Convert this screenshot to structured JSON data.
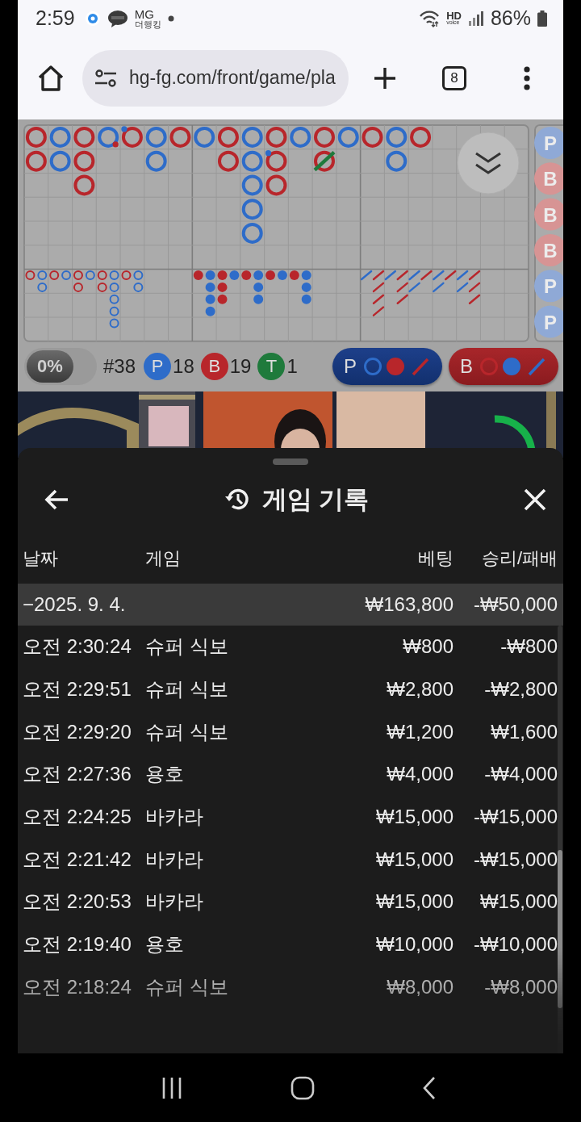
{
  "status_bar": {
    "time": "2:59",
    "app_label": "MG",
    "app_sublabel": "더행킹",
    "network": "HD",
    "network_sub": "voice",
    "battery": "86%"
  },
  "browser": {
    "url": "hg-fg.com/front/game/pla",
    "tab_count": "8"
  },
  "roadmap": {
    "big_road": [
      [
        {
          "kind": "banker",
          "player_pair": false,
          "banker_pair": false,
          "tie": false
        },
        {
          "kind": "banker",
          "player_pair": false,
          "banker_pair": false,
          "tie": false
        }
      ],
      [
        {
          "kind": "player",
          "player_pair": false,
          "banker_pair": false,
          "tie": false
        },
        {
          "kind": "player",
          "player_pair": false,
          "banker_pair": false,
          "tie": false
        }
      ],
      [
        {
          "kind": "banker",
          "player_pair": false,
          "banker_pair": false,
          "tie": false
        },
        {
          "kind": "banker",
          "player_pair": false,
          "banker_pair": false,
          "tie": false
        },
        {
          "kind": "banker",
          "player_pair": false,
          "banker_pair": false,
          "tie": false
        }
      ],
      [
        {
          "kind": "player",
          "player_pair": false,
          "banker_pair": true,
          "tie": false
        }
      ],
      [
        {
          "kind": "banker",
          "player_pair": true,
          "banker_pair": false,
          "tie": false
        }
      ],
      [
        {
          "kind": "player",
          "player_pair": false,
          "banker_pair": false,
          "tie": false
        },
        {
          "kind": "player",
          "player_pair": false,
          "banker_pair": false,
          "tie": false
        }
      ],
      [
        {
          "kind": "banker",
          "player_pair": false,
          "banker_pair": false,
          "tie": false
        }
      ],
      [
        {
          "kind": "player",
          "player_pair": false,
          "banker_pair": false,
          "tie": false
        }
      ],
      [
        {
          "kind": "banker",
          "player_pair": false,
          "banker_pair": false,
          "tie": false
        },
        {
          "kind": "banker",
          "player_pair": false,
          "banker_pair": false,
          "tie": false
        }
      ],
      [
        {
          "kind": "player",
          "player_pair": false,
          "banker_pair": false,
          "tie": false
        },
        {
          "kind": "player",
          "player_pair": false,
          "banker_pair": false,
          "tie": false
        },
        {
          "kind": "player",
          "player_pair": false,
          "banker_pair": false,
          "tie": false
        },
        {
          "kind": "player",
          "player_pair": false,
          "banker_pair": false,
          "tie": false
        },
        {
          "kind": "player",
          "player_pair": false,
          "banker_pair": false,
          "tie": false
        }
      ],
      [
        {
          "kind": "banker",
          "player_pair": false,
          "banker_pair": false,
          "tie": false
        },
        {
          "kind": "banker",
          "player_pair": true,
          "banker_pair": false,
          "tie": false
        },
        {
          "kind": "banker",
          "player_pair": false,
          "banker_pair": false,
          "tie": false
        }
      ],
      [
        {
          "kind": "player",
          "player_pair": false,
          "banker_pair": false,
          "tie": false
        }
      ],
      [
        {
          "kind": "banker",
          "player_pair": false,
          "banker_pair": false,
          "tie": false
        },
        {
          "kind": "banker",
          "player_pair": false,
          "banker_pair": false,
          "tie": true
        }
      ],
      [
        {
          "kind": "player",
          "player_pair": false,
          "banker_pair": false,
          "tie": false
        }
      ],
      [
        {
          "kind": "banker",
          "player_pair": false,
          "banker_pair": false,
          "tie": false
        }
      ],
      [
        {
          "kind": "player",
          "player_pair": false,
          "banker_pair": false,
          "tie": false
        },
        {
          "kind": "player",
          "player_pair": false,
          "banker_pair": false,
          "tie": false
        }
      ],
      [
        {
          "kind": "banker",
          "player_pair": false,
          "banker_pair": false,
          "tie": false
        }
      ]
    ],
    "big_eye_road": [
      [
        {
          "kind": "banker"
        }
      ],
      [
        {
          "kind": "player"
        },
        {
          "kind": "player"
        }
      ],
      [
        {
          "kind": "banker"
        }
      ],
      [
        {
          "kind": "player"
        }
      ],
      [
        {
          "kind": "banker"
        },
        {
          "kind": "banker"
        }
      ],
      [
        {
          "kind": "player"
        }
      ],
      [
        {
          "kind": "banker"
        },
        {
          "kind": "banker"
        }
      ],
      [
        {
          "kind": "player"
        },
        {
          "kind": "player"
        },
        {
          "kind": "player"
        },
        {
          "kind": "player"
        },
        {
          "kind": "player"
        }
      ],
      [
        {
          "kind": "banker"
        }
      ],
      [
        {
          "kind": "player"
        },
        {
          "kind": "player"
        }
      ]
    ],
    "small_road": [
      [
        {
          "kind": "banker"
        }
      ],
      [
        {
          "kind": "player"
        },
        {
          "kind": "player"
        },
        {
          "kind": "player"
        },
        {
          "kind": "player"
        }
      ],
      [
        {
          "kind": "banker"
        },
        {
          "kind": "banker"
        },
        {
          "kind": "banker"
        }
      ],
      [
        {
          "kind": "player"
        }
      ],
      [
        {
          "kind": "banker"
        }
      ],
      [
        {
          "kind": "player"
        },
        {
          "kind": "player"
        },
        {
          "kind": "player"
        }
      ],
      [
        {
          "kind": "banker"
        }
      ],
      [
        {
          "kind": "player"
        }
      ],
      [
        {
          "kind": "banker"
        }
      ],
      [
        {
          "kind": "player"
        },
        {
          "kind": "player"
        },
        {
          "kind": "player"
        }
      ]
    ],
    "cockroach_road": [
      [
        {
          "kind": "player"
        }
      ],
      [
        {
          "kind": "banker"
        },
        {
          "kind": "banker"
        },
        {
          "kind": "banker"
        },
        {
          "kind": "banker"
        }
      ],
      [
        {
          "kind": "player"
        }
      ],
      [
        {
          "kind": "banker"
        },
        {
          "kind": "banker"
        },
        {
          "kind": "banker"
        }
      ],
      [
        {
          "kind": "player"
        },
        {
          "kind": "player"
        }
      ],
      [
        {
          "kind": "banker"
        }
      ],
      [
        {
          "kind": "player"
        },
        {
          "kind": "player"
        }
      ],
      [
        {
          "kind": "banker"
        }
      ],
      [
        {
          "kind": "player"
        },
        {
          "kind": "player"
        }
      ],
      [
        {
          "kind": "banker"
        },
        {
          "kind": "banker"
        },
        {
          "kind": "banker"
        }
      ]
    ],
    "side_beads": [
      {
        "kind": "player",
        "label": "P"
      },
      {
        "kind": "banker",
        "label": "B"
      },
      {
        "kind": "banker",
        "label": "B"
      },
      {
        "kind": "banker",
        "label": "B"
      },
      {
        "kind": "player",
        "label": "P"
      },
      {
        "kind": "player",
        "label": "P"
      }
    ]
  },
  "stats": {
    "toggle": "0%",
    "round": "#38",
    "counts": [
      {
        "kind": "player",
        "label": "P",
        "count": "18"
      },
      {
        "kind": "banker",
        "label": "B",
        "count": "19"
      },
      {
        "kind": "tie",
        "label": "T",
        "count": "1"
      }
    ],
    "predictions": [
      {
        "kind": "player",
        "label": "P"
      },
      {
        "kind": "banker",
        "label": "B"
      }
    ]
  },
  "sheet": {
    "title": "게임 기록",
    "columns": [
      "날짜",
      "게임",
      "베팅",
      "승리/패배"
    ],
    "group": {
      "date": "−2025. 9. 4.",
      "bet": "₩163,800",
      "result": "-₩50,000"
    },
    "rows": [
      {
        "time": "오전 2:30:24",
        "game": "슈퍼 식보",
        "bet": "₩800",
        "result": "-₩800"
      },
      {
        "time": "오전 2:29:51",
        "game": "슈퍼 식보",
        "bet": "₩2,800",
        "result": "-₩2,800"
      },
      {
        "time": "오전 2:29:20",
        "game": "슈퍼 식보",
        "bet": "₩1,200",
        "result": "₩1,600"
      },
      {
        "time": "오전 2:27:36",
        "game": "용호",
        "bet": "₩4,000",
        "result": "-₩4,000"
      },
      {
        "time": "오전 2:24:25",
        "game": "바카라",
        "bet": "₩15,000",
        "result": "-₩15,000"
      },
      {
        "time": "오전 2:21:42",
        "game": "바카라",
        "bet": "₩15,000",
        "result": "-₩15,000"
      },
      {
        "time": "오전 2:20:53",
        "game": "바카라",
        "bet": "₩15,000",
        "result": "₩15,000"
      },
      {
        "time": "오전 2:19:40",
        "game": "용호",
        "bet": "₩10,000",
        "result": "-₩10,000"
      },
      {
        "time": "오전 2:18:24",
        "game": "슈퍼 식보",
        "bet": "₩8,000",
        "result": "-₩8,000"
      }
    ]
  }
}
